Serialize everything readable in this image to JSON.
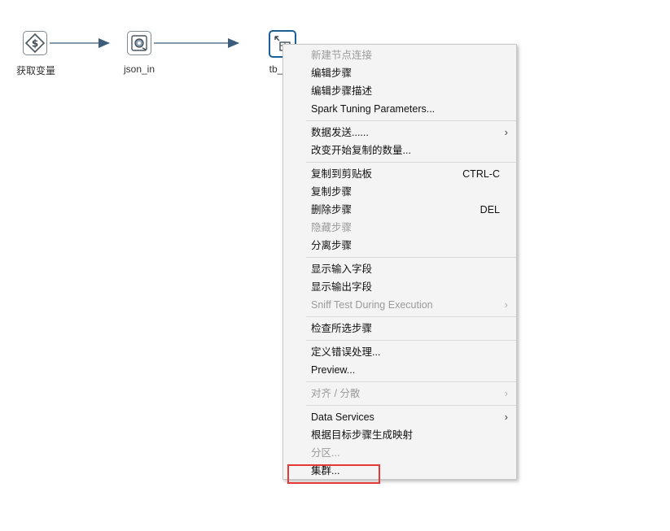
{
  "steps": [
    {
      "id": "get-variable",
      "label": "获取变量",
      "icon": "dollar-diamond-icon"
    },
    {
      "id": "json-in",
      "label": "json_in",
      "icon": "json-input-icon"
    },
    {
      "id": "table-output",
      "label": "tb_",
      "icon": "table-output-icon"
    }
  ],
  "colors": {
    "hop_line": "#3d5b7a",
    "selected_border": "#1a5f95",
    "highlight": "#e53935",
    "menu_bg": "#f4f4f4"
  },
  "context_menu": {
    "groups": [
      [
        {
          "label": "新建节点连接",
          "disabled": true
        },
        {
          "label": "编辑步骤"
        },
        {
          "label": "编辑步骤描述"
        },
        {
          "label": "Spark Tuning Parameters..."
        }
      ],
      [
        {
          "label": "数据发送......",
          "submenu": true
        },
        {
          "label": "改变开始复制的数量..."
        }
      ],
      [
        {
          "label": "复制到剪贴板",
          "shortcut": "CTRL-C"
        },
        {
          "label": "复制步骤"
        },
        {
          "label": "删除步骤",
          "shortcut": "DEL"
        },
        {
          "label": "隐藏步骤",
          "disabled": true
        },
        {
          "label": "分离步骤"
        }
      ],
      [
        {
          "label": "显示输入字段"
        },
        {
          "label": "显示输出字段"
        },
        {
          "label": "Sniff Test During Execution",
          "disabled": true,
          "submenu": true
        }
      ],
      [
        {
          "label": "检查所选步骤"
        }
      ],
      [
        {
          "label": "定义错误处理..."
        },
        {
          "label": "Preview..."
        }
      ],
      [
        {
          "label": "对齐 / 分散",
          "disabled": true,
          "submenu": true
        }
      ],
      [
        {
          "label": "Data Services",
          "submenu": true
        },
        {
          "label": "根据目标步骤生成映射"
        },
        {
          "label": "分区...",
          "disabled": true
        },
        {
          "label": "集群...",
          "highlighted": true
        }
      ]
    ]
  }
}
